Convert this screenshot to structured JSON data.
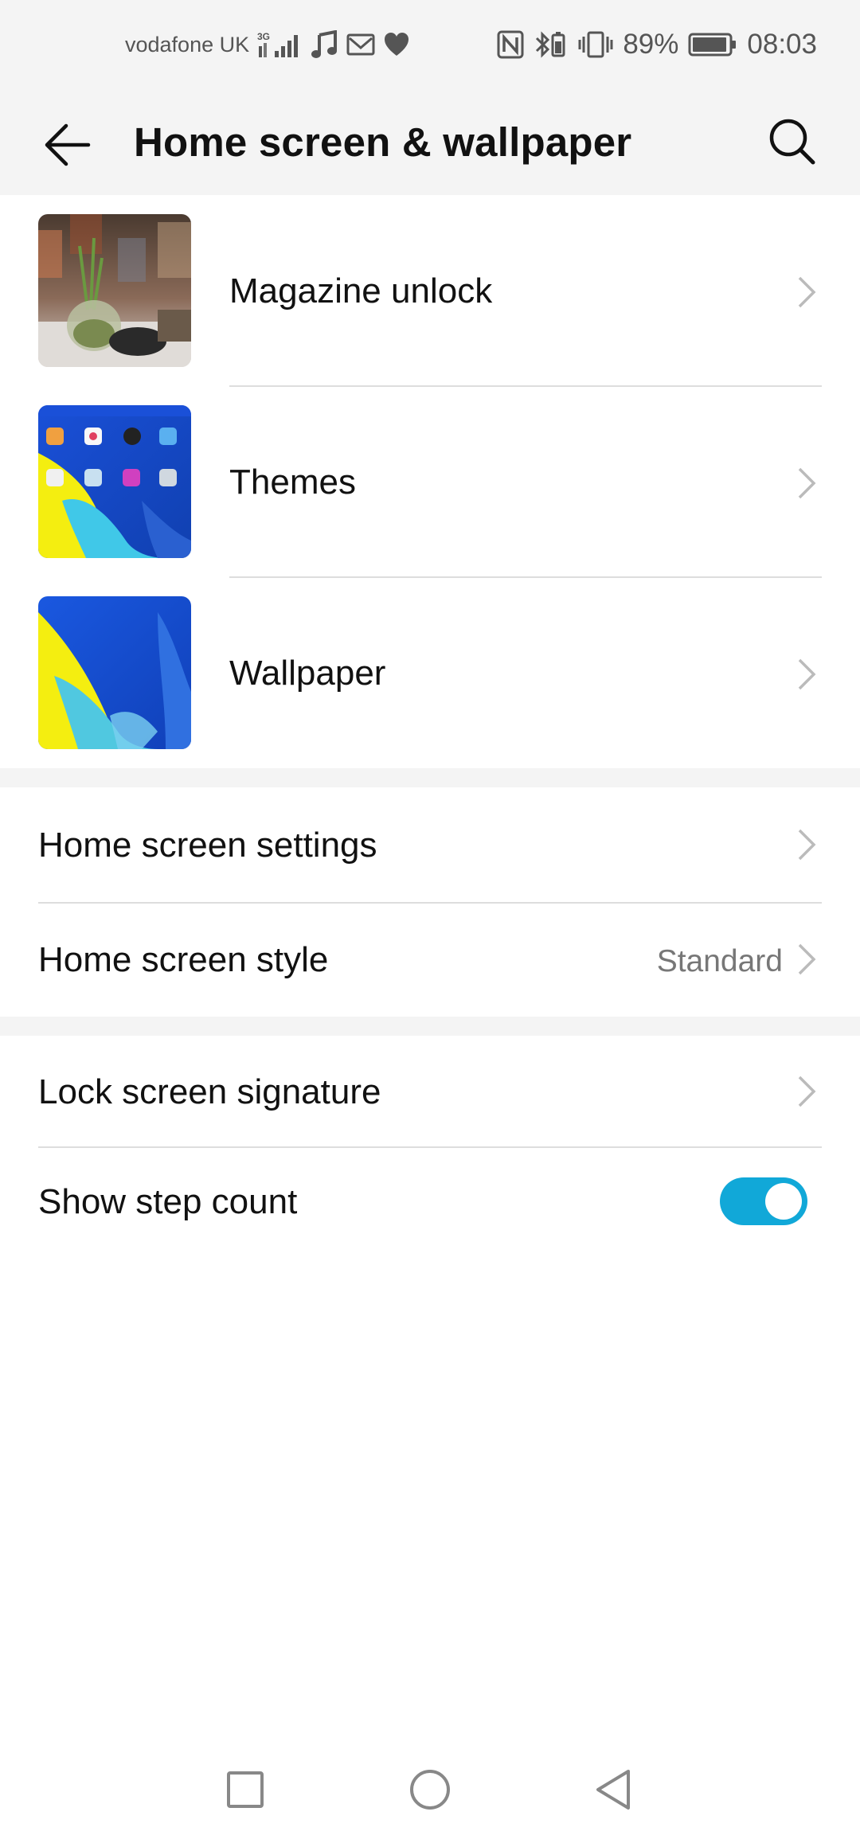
{
  "status_bar": {
    "carrier": "vodafone UK",
    "network": "3G",
    "battery_percent": "89%",
    "time": "08:03"
  },
  "app_bar": {
    "title": "Home screen & wallpaper"
  },
  "thumb_items": [
    {
      "label": "Magazine unlock"
    },
    {
      "label": "Themes"
    },
    {
      "label": "Wallpaper"
    }
  ],
  "home_group": {
    "settings_label": "Home screen settings",
    "style_label": "Home screen style",
    "style_value": "Standard"
  },
  "lock_group": {
    "signature_label": "Lock screen signature",
    "step_count_label": "Show step count",
    "step_count_enabled": true
  },
  "colors": {
    "accent": "#11a8d8",
    "header_bg": "#f4f4f4"
  }
}
